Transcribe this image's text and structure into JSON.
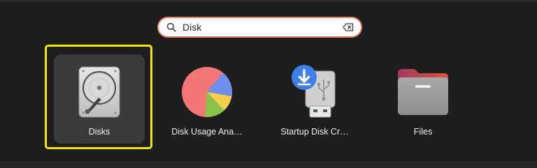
{
  "search": {
    "value": "Disk",
    "placeholder": ""
  },
  "apps": [
    {
      "label": "Disks",
      "icon": "hard-disk-icon"
    },
    {
      "label": "Disk Usage Ana…",
      "icon": "pie-chart-icon"
    },
    {
      "label": "Startup Disk Cr…",
      "icon": "usb-download-icon"
    },
    {
      "label": "Files",
      "icon": "folder-icon"
    }
  ],
  "colors": {
    "highlight": "#f3e600",
    "search_border": "#e9845f",
    "background": "#1e1e1e",
    "selected_tile": "#3a3a3a"
  },
  "icons": {
    "search": "search-icon",
    "clear": "clear-icon"
  }
}
